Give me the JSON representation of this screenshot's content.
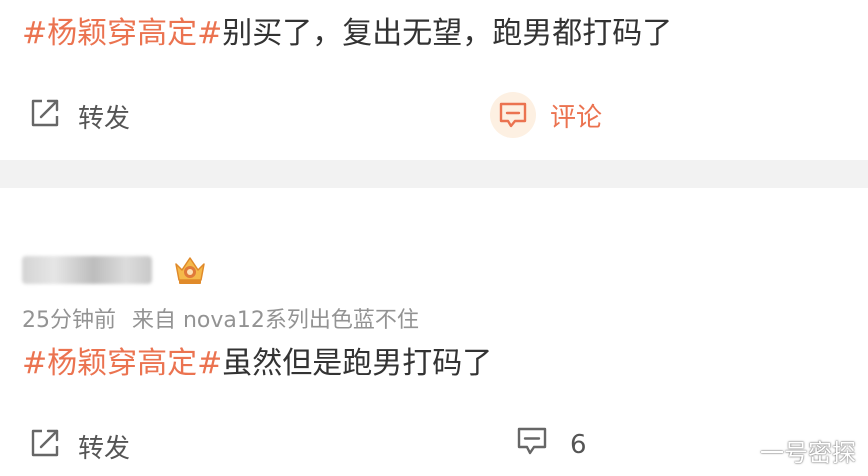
{
  "post1": {
    "hashtag": "#杨颖穿高定#",
    "text": "别买了，复出无望，跑男都打码了",
    "share_label": "转发",
    "comment_label": "评论"
  },
  "post2": {
    "time": "25分钟前",
    "source": "来自 nova12系列出色蓝不住",
    "hashtag": "#杨颖穿高定#",
    "text": "虽然但是跑男打码了",
    "share_label": "转发",
    "comment_count": "6"
  },
  "watermark": "一号密探",
  "icons": {
    "share": "share-icon",
    "comment": "comment-icon",
    "badge": "crown-badge-icon"
  },
  "colors": {
    "hashtag": "#eb7350",
    "comment_active": "#eb7350",
    "meta": "#939393",
    "divider": "#f2f2f2"
  }
}
